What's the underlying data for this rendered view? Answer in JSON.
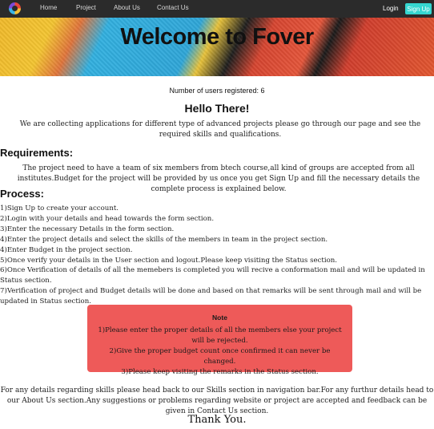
{
  "nav": {
    "links": [
      "Home",
      "Project",
      "About Us",
      "Contact Us"
    ],
    "login": "Login",
    "signup": "Sign Up"
  },
  "hero": {
    "title": "Welcome to Fover"
  },
  "stats": {
    "users_registered": "Number of users registered: 6"
  },
  "intro": {
    "heading": "Hello There!",
    "text": "We are collecting applications for different type of advanced projects please go through our page and see the required skills and qualifications."
  },
  "requirements": {
    "heading": "Requirements:",
    "text": "The project need to have a team of six members from btech course,all kind of groups are accepted from all institutes.Budget for the project will be provided by us once you get Sign Up and fill the necessary details the complete process is explained below."
  },
  "process": {
    "heading": "Process:",
    "steps": [
      "1)Sign Up to create your account.",
      "2)Login with your details and head towards the form section.",
      "3)Enter the necessary Details in the form section.",
      "4)Enter the project details and select the skills of the members in team in the project section.",
      "4)Enter Budget in the project section.",
      "5)Once verify your details in the User section and logout.Please keep visiting the Status section.",
      "6)Once Verification of details of all the memebers is completed you will recive a conformation mail and will be updated in Status section.",
      "7)Verification of project and Budget details will be done and based on that remarks will be sent through mail and will be updated in Status section."
    ]
  },
  "note": {
    "title": "Note",
    "lines": [
      "1)Please enter the proper details of all the members else your project will be rejected.",
      "2)Give the proper budget count once confirmed it can never be changed.",
      "3)Please keep visiting the remarks in the Status section."
    ]
  },
  "footer": {
    "text": "For any details regarding skills please head back to our Skills section in navigation bar.For any furthur details head to our About Us section.Any suggestions or problems regarding website or project are accepted and feedback can be given in Contact Us section.",
    "thanks": "Thank You."
  },
  "colors": {
    "navbar": "#2b2b2b",
    "signup_button": "#35d6d0",
    "note_background": "#ee5a59"
  }
}
